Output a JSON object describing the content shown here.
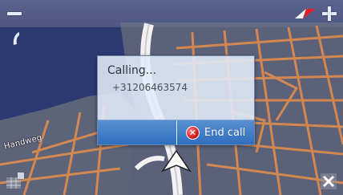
{
  "dialog": {
    "title": "Calling...",
    "number": "+31206463574",
    "end_call_label": "End call",
    "end_call_icon": "x-circle-icon"
  },
  "map": {
    "street_label": "Handweg"
  },
  "hud_icons": {
    "zoom_out": "minus-icon",
    "zoom_in": "plus-icon",
    "compass": "compass-icon",
    "phone": "phone-icon",
    "menu": "grid-menu-icon",
    "close": "close-icon"
  },
  "colors": {
    "water": "#2c3a72",
    "land": "#5a607a",
    "road": "#d8884a",
    "dialog_bar": "#3b78c4",
    "end_call_icon": "#d11a1a"
  }
}
